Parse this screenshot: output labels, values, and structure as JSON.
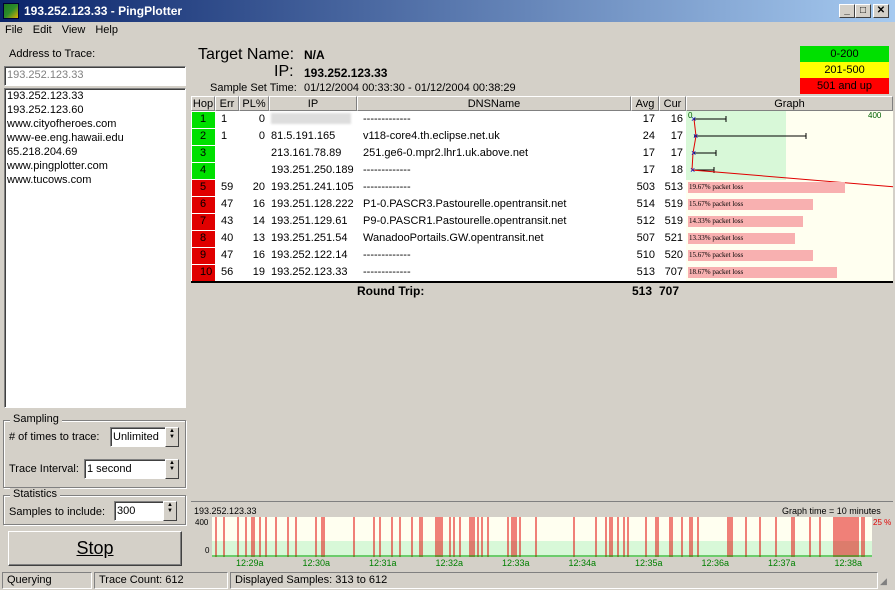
{
  "window": {
    "title": "193.252.123.33 - PingPlotter"
  },
  "menu": [
    "File",
    "Edit",
    "View",
    "Help"
  ],
  "left": {
    "address_label": "Address to Trace:",
    "address_value": "193.252.123.33",
    "history": [
      "193.252.123.33",
      "193.252.123.60",
      "www.cityofheroes.com",
      "www-ee.eng.hawaii.edu",
      "65.218.204.69",
      "www.pingplotter.com",
      "www.tucows.com"
    ],
    "sampling": {
      "title": "Sampling",
      "times_label": "# of times to trace:",
      "times_value": "Unlimited",
      "interval_label": "Trace Interval:",
      "interval_value": "1 second"
    },
    "statistics": {
      "title": "Statistics",
      "samples_label": "Samples to include:",
      "samples_value": "300"
    },
    "stop_label": "Stop"
  },
  "header": {
    "target_label": "Target Name:",
    "target_value": "N/A",
    "ip_label": "IP:",
    "ip_value": "193.252.123.33",
    "sample_label": "Sample Set Time:",
    "sample_value": "01/12/2004 00:33:30 - 01/12/2004 00:38:29"
  },
  "legend": [
    {
      "label": "0-200",
      "color": "#00e000"
    },
    {
      "label": "201-500",
      "color": "#ffff00"
    },
    {
      "label": "501 and up",
      "color": "#ff0000"
    }
  ],
  "table": {
    "columns": [
      "Hop",
      "Err",
      "PL%",
      "IP",
      "DNSName",
      "Avg",
      "Cur",
      "Graph"
    ],
    "graph_scale_start": "0",
    "graph_scale_end": "400",
    "rows": [
      {
        "hop": "1",
        "err": "1",
        "pl": "0",
        "ip": "",
        "dns": "-------------",
        "avg": "17",
        "cur": "16",
        "color": "#00e000",
        "plbar": ""
      },
      {
        "hop": "2",
        "err": "1",
        "pl": "0",
        "ip": "81.5.191.165",
        "dns": "v118-core4.th.eclipse.net.uk",
        "avg": "24",
        "cur": "17",
        "color": "#00e000",
        "plbar": ""
      },
      {
        "hop": "3",
        "err": "",
        "pl": "",
        "ip": "213.161.78.89",
        "dns": "251.ge6-0.mpr2.lhr1.uk.above.net",
        "avg": "17",
        "cur": "17",
        "color": "#00e000",
        "plbar": ""
      },
      {
        "hop": "4",
        "err": "",
        "pl": "",
        "ip": "193.251.250.189",
        "dns": "-------------",
        "avg": "17",
        "cur": "18",
        "color": "#00e000",
        "plbar": ""
      },
      {
        "hop": "5",
        "err": "59",
        "pl": "20",
        "ip": "193.251.241.105",
        "dns": "-------------",
        "avg": "503",
        "cur": "513",
        "color": "#e00000",
        "plbar": "19.67% packet loss",
        "plv": 19.67
      },
      {
        "hop": "6",
        "err": "47",
        "pl": "16",
        "ip": "193.251.128.222",
        "dns": "P1-0.PASCR3.Pastourelle.opentransit.net",
        "avg": "514",
        "cur": "519",
        "color": "#e00000",
        "plbar": "15.67% packet loss",
        "plv": 15.67
      },
      {
        "hop": "7",
        "err": "43",
        "pl": "14",
        "ip": "193.251.129.61",
        "dns": "P9-0.PASCR1.Pastourelle.opentransit.net",
        "avg": "512",
        "cur": "519",
        "color": "#e00000",
        "plbar": "14.33% packet loss",
        "plv": 14.33
      },
      {
        "hop": "8",
        "err": "40",
        "pl": "13",
        "ip": "193.251.251.54",
        "dns": "WanadooPortails.GW.opentransit.net",
        "avg": "507",
        "cur": "521",
        "color": "#e00000",
        "plbar": "13.33% packet loss",
        "plv": 13.33
      },
      {
        "hop": "9",
        "err": "47",
        "pl": "16",
        "ip": "193.252.122.14",
        "dns": "-------------",
        "avg": "510",
        "cur": "520",
        "color": "#e00000",
        "plbar": "15.67% packet loss",
        "plv": 15.67
      },
      {
        "hop": "10",
        "err": "56",
        "pl": "19",
        "ip": "193.252.123.33",
        "dns": "-------------",
        "avg": "513",
        "cur": "707",
        "color": "#e00000",
        "plbar": "18.67% packet loss",
        "plv": 18.67
      }
    ],
    "round_trip_label": "Round Trip:",
    "round_trip_avg": "513",
    "round_trip_cur": "707"
  },
  "timeline": {
    "host": "193.252.123.33",
    "graph_time": "Graph time = 10 minutes",
    "y_top": "400",
    "y_bottom": "0",
    "loss_label": "25 %",
    "times": [
      "12:29a",
      "12:30a",
      "12:31a",
      "12:32a",
      "12:33a",
      "12:34a",
      "12:35a",
      "12:36a",
      "12:37a",
      "12:38a"
    ]
  },
  "status": {
    "state": "Querying",
    "trace_count": "Trace Count: 612",
    "displayed": "Displayed Samples: 313 to 612"
  }
}
